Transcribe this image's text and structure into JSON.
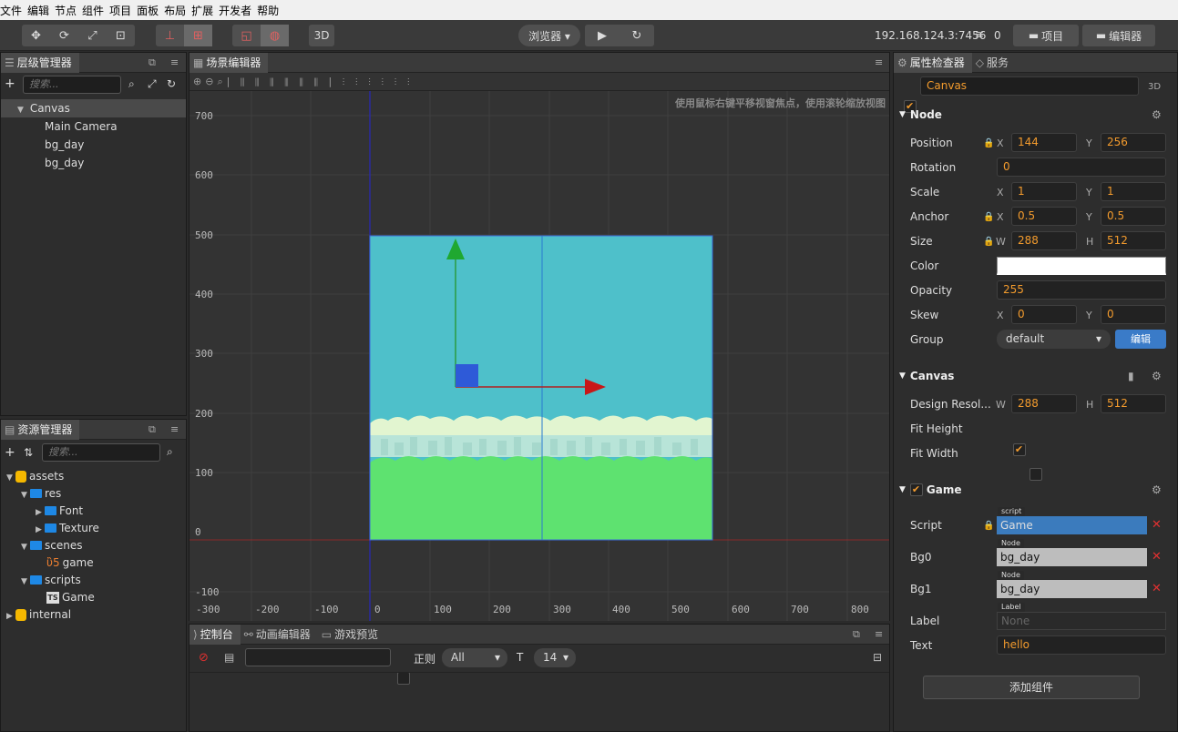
{
  "menu": [
    "文件",
    "编辑",
    "节点",
    "组件",
    "项目",
    "面板",
    "布局",
    "扩展",
    "开发者",
    "帮助"
  ],
  "toolbar": {
    "dim_label": "3D",
    "browser_label": "浏览器 ▾",
    "ip": "192.168.124.3:7456",
    "wifi_count": "0",
    "project_label": "项目",
    "editor_label": "编辑器"
  },
  "hierarchy": {
    "title": "层级管理器",
    "search_placeholder": "搜索...",
    "items": [
      {
        "label": "Canvas"
      },
      {
        "label": "Main Camera"
      },
      {
        "label": "bg_day"
      },
      {
        "label": "bg_day"
      }
    ]
  },
  "assets": {
    "title": "资源管理器",
    "search_placeholder": "搜索...",
    "items": [
      {
        "label": "assets"
      },
      {
        "label": "res"
      },
      {
        "label": "Font"
      },
      {
        "label": "Texture"
      },
      {
        "label": "scenes"
      },
      {
        "label": "game"
      },
      {
        "label": "scripts"
      },
      {
        "label": "Game"
      },
      {
        "label": "internal"
      }
    ]
  },
  "scene": {
    "title": "场景编辑器",
    "hint": "使用鼠标右键平移视窗焦点，使用滚轮缩放视图",
    "y_ticks": [
      "700",
      "600",
      "500",
      "400",
      "300",
      "200",
      "100",
      "0",
      "-100"
    ],
    "x_ticks": [
      "-300",
      "-200",
      "-100",
      "0",
      "100",
      "200",
      "300",
      "400",
      "500",
      "600",
      "700",
      "800"
    ]
  },
  "console": {
    "tabs": [
      "控制台",
      "动画编辑器",
      "游戏预览"
    ],
    "regex_label": "正则",
    "level": "All",
    "font_size": "14"
  },
  "inspector": {
    "tabs": [
      "属性检查器",
      "服务"
    ],
    "node_name": "Canvas",
    "dim_label": "3D",
    "node_section": "Node",
    "position": {
      "label": "Position",
      "x": "144",
      "y": "256"
    },
    "rotation": {
      "label": "Rotation",
      "value": "0"
    },
    "scale": {
      "label": "Scale",
      "x": "1",
      "y": "1"
    },
    "anchor": {
      "label": "Anchor",
      "x": "0.5",
      "y": "0.5"
    },
    "size": {
      "label": "Size",
      "w": "288",
      "h": "512"
    },
    "color": {
      "label": "Color"
    },
    "opacity": {
      "label": "Opacity",
      "value": "255"
    },
    "skew": {
      "label": "Skew",
      "x": "0",
      "y": "0"
    },
    "group": {
      "label": "Group",
      "value": "default",
      "edit": "编辑"
    },
    "canvas_section": "Canvas",
    "design_res": {
      "label": "Design Resol...",
      "w": "288",
      "h": "512"
    },
    "fit_height": {
      "label": "Fit Height"
    },
    "fit_width": {
      "label": "Fit Width"
    },
    "game_section": "Game",
    "script": {
      "label": "Script",
      "tag": "script",
      "value": "Game"
    },
    "bg0": {
      "label": "Bg0",
      "tag": "Node",
      "value": "bg_day"
    },
    "bg1": {
      "label": "Bg1",
      "tag": "Node",
      "value": "bg_day"
    },
    "label_prop": {
      "label": "Label",
      "tag": "Label",
      "value": "None"
    },
    "text": {
      "label": "Text",
      "value": "hello"
    },
    "add_component": "添加组件"
  }
}
